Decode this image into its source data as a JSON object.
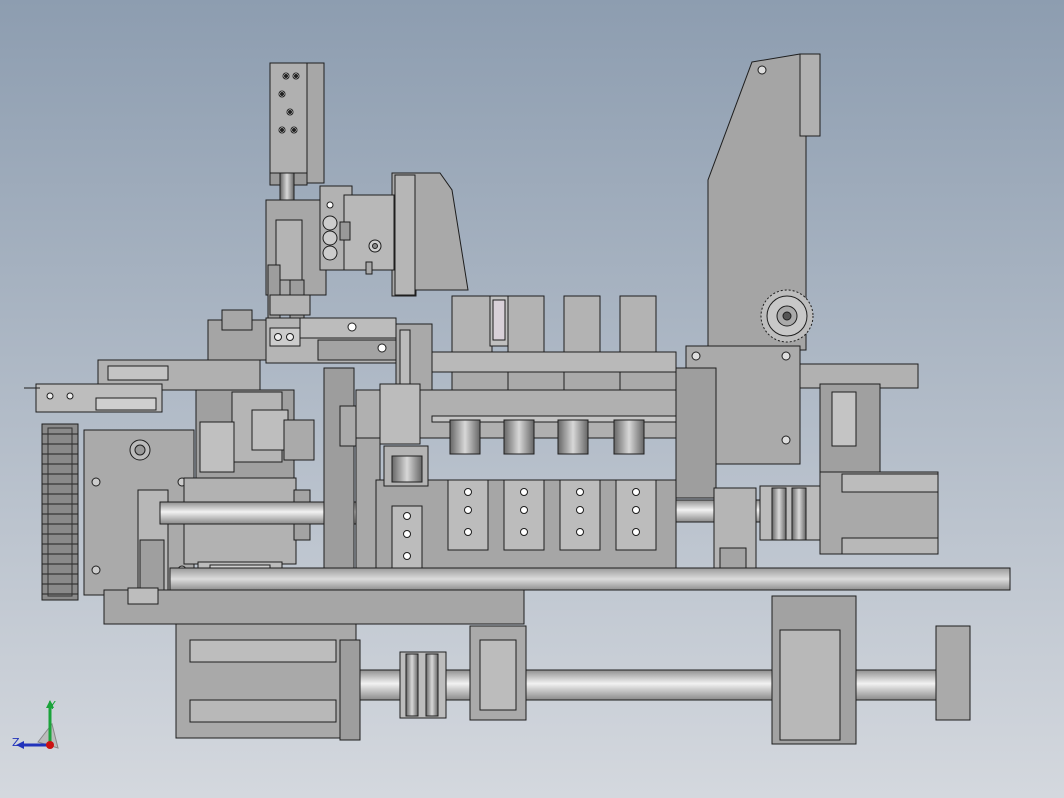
{
  "axis_triad": {
    "y_label": "Y",
    "z_label": "Z"
  },
  "colors": {
    "background_top": "#8d9db0",
    "background_bottom": "#d4d8de",
    "part_fill": "#a7a7a7",
    "part_light": "#bdbdbd",
    "part_dark": "#8c8c8c",
    "edge": "#1e1e1e",
    "shaft_highlight": "#f2f2f2",
    "axis_y": "#1aa33a",
    "axis_z": "#2233bb",
    "axis_x": "#cc1111"
  }
}
